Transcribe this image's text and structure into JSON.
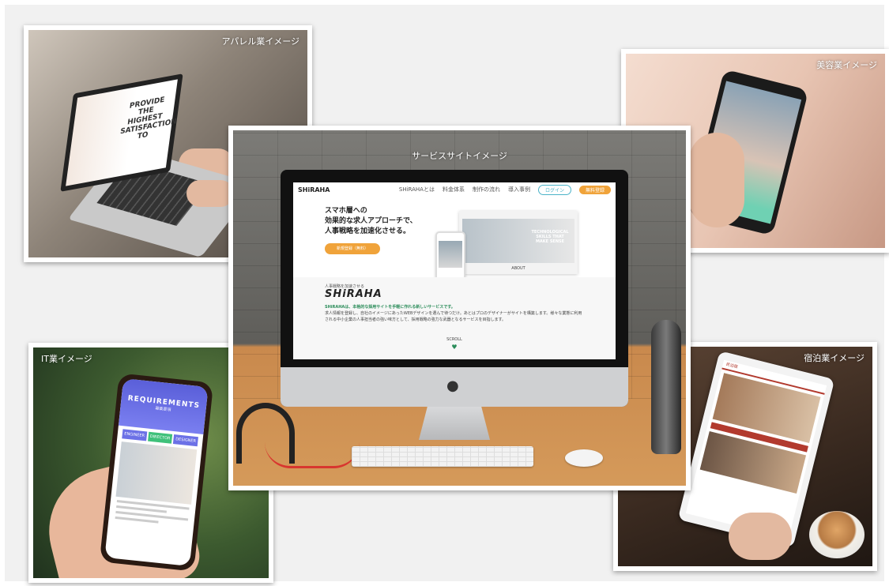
{
  "captions": {
    "apparel": "アパレル業イメージ",
    "beauty": "美容業イメージ",
    "service": "サービスサイトイメージ",
    "it": "IT業イメージ",
    "lodging": "宿泊業イメージ"
  },
  "apparel_screen": {
    "headline": "PROVIDE THE HIGHEST SATISFACTION TO"
  },
  "service_site": {
    "logo": "SHiRAHA",
    "nav": [
      "SHiRAHAとは",
      "料金体系",
      "制作の流れ",
      "導入事例"
    ],
    "login_button": "ログイン",
    "signup_button": "無料登録",
    "hero_lines": [
      "スマホ層への",
      "効果的な求人アプローチで、",
      "人事戦略を加速化させる。"
    ],
    "hero_cta": "新規登録（無料）",
    "mock_title": "TECHNOLOGICAL SKILLS THAT MAKE SENSE",
    "mock_about": "ABOUT",
    "sub_heading": "人事戦略を加速させる",
    "brand": "SHiRAHA",
    "desc_strong": "SHiRAHAは、本格的な採用サイトを手軽に作れる新しいサービスです。",
    "desc_rest": "求人情報を登録し、自社のイメージにあったWEBデザインを選んで待つだけ。あとはプロのデザイナーがサイトを構築します。様々な業態に利用される中小企業の人事担当者の強い味方として、採用戦略の強力な武器となるサービスを目指します。",
    "scroll": "SCROLL",
    "heart": "♥"
  },
  "it_screen": {
    "title": "REQUIREMENTS",
    "subtitle": "募集要項",
    "tabs": [
      "ENGINEER",
      "DIRECTOR",
      "DESIGNER"
    ]
  },
  "lodging_screen": {
    "brand": "民泊宿"
  },
  "colors": {
    "accent_orange": "#f0a33a",
    "accent_green": "#2a8c59",
    "it_purple": "#5a5fd9",
    "lodging_red": "#b23a2e"
  }
}
